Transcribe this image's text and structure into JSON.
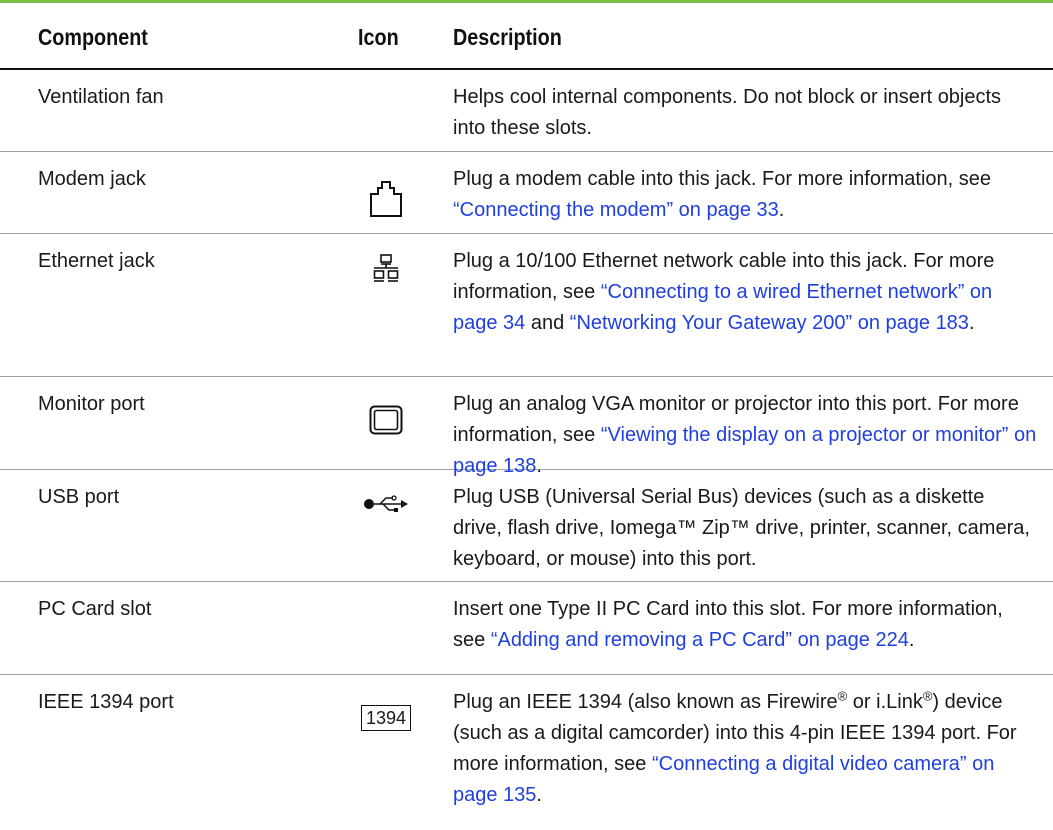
{
  "headers": {
    "component": "Component",
    "icon": "Icon",
    "description": "Description"
  },
  "rows": [
    {
      "component": "Ventilation fan",
      "icon": "",
      "d1": "Helps cool internal components. Do not block or insert objects into these slots."
    },
    {
      "component": "Modem jack",
      "icon": "modem-jack-icon",
      "d1": "Plug a modem cable into this jack. For more information, see ",
      "l1": "“Connecting the modem” on page 33",
      "d2": "."
    },
    {
      "component": "Ethernet jack",
      "icon": "ethernet-network-icon",
      "d1": "Plug a 10/100 Ethernet network cable into this jack. For more information, see ",
      "l1": "“Connecting to a wired Ethernet network” on page 34",
      "d2": " and ",
      "l2": "“Networking Your Gateway 200” on page 183",
      "d3": "."
    },
    {
      "component": "Monitor port",
      "icon": "monitor-icon",
      "d1": "Plug an analog VGA monitor or projector into this port. For more information, see ",
      "l1": "“Viewing the display on a projector or monitor” on page 138",
      "d2": "."
    },
    {
      "component": "USB port",
      "icon": "usb-icon",
      "d1": "Plug USB (Universal Serial Bus) devices (such as a diskette drive, flash drive, Iomega™ Zip™ drive, printer, scanner, camera, keyboard, or mouse) into this port."
    },
    {
      "component": "PC Card slot",
      "icon": "",
      "d1": "Insert one Type II PC Card into this slot. For more information, see ",
      "l1": "“Adding and removing a PC Card” on page 224",
      "d2": "."
    },
    {
      "component": "IEEE 1394 port",
      "icon": "ieee1394-icon",
      "icon_text": "1394",
      "d1": "Plug an IEEE 1394 (also known as Firewire",
      "reg1": "®",
      "d2": " or i.Link",
      "reg2": "®",
      "d3": ") device (such as a digital camcorder) into this 4-pin IEEE 1394 port. For more information, see ",
      "l1": "“Connecting a digital video camera” on page 135",
      "d4": "."
    }
  ],
  "colors": {
    "accent": "#7ac143",
    "link": "#1f3fe0",
    "rule": "#9fa4a8"
  }
}
